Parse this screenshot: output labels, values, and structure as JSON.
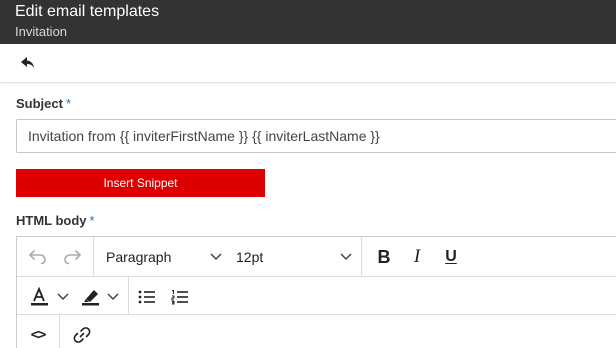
{
  "header": {
    "title": "Edit email templates",
    "subtitle": "Invitation"
  },
  "form": {
    "subject_label": "Subject",
    "required_marker": "*",
    "subject_value": "Invitation from {{ inviterFirstName }} {{ inviterLastName }}",
    "insert_snippet_label": "Insert Snippet",
    "html_body_label": "HTML body"
  },
  "editor": {
    "block_format": "Paragraph",
    "font_size": "12pt",
    "bold_glyph": "B",
    "italic_glyph": "I",
    "underline_glyph": "U",
    "code_glyph": "<>"
  },
  "colors": {
    "header_bg": "#333333",
    "accent_red": "#dd0000",
    "required_blue": "#1e73be"
  },
  "icons": [
    "back-arrow-icon",
    "undo-icon",
    "redo-icon",
    "chevron-down-icon",
    "text-color-icon",
    "highlight-icon",
    "bullet-list-icon",
    "numbered-list-icon",
    "source-code-icon",
    "link-icon"
  ]
}
